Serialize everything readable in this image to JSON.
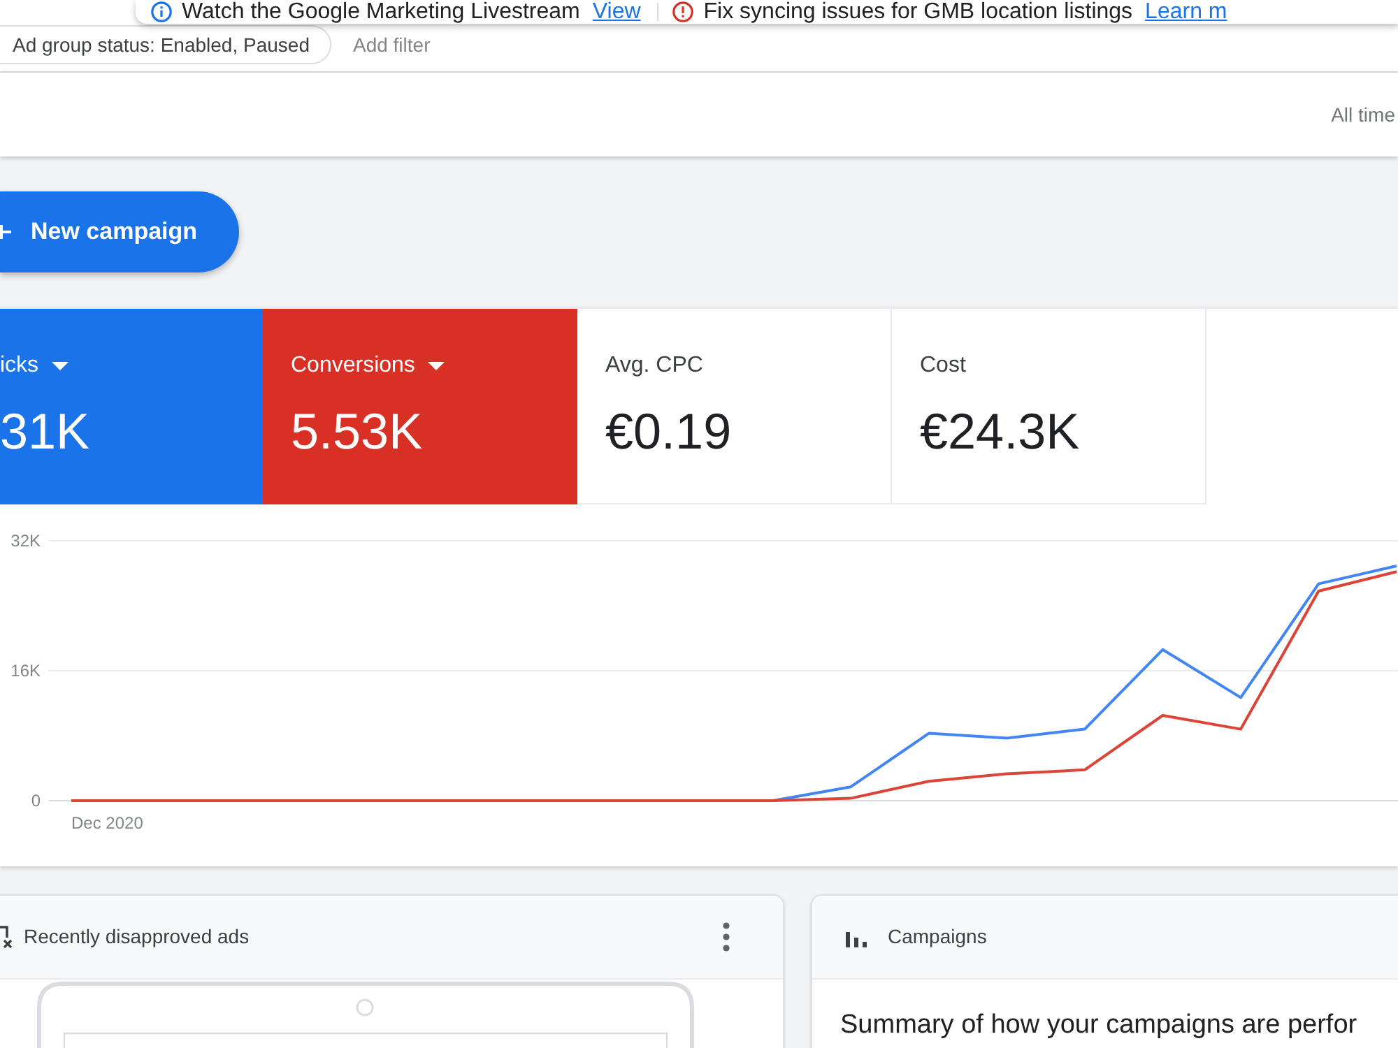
{
  "banner": {
    "messages": [
      {
        "kind": "info",
        "text": "Watch the Google Marketing Livestream",
        "link": "View"
      },
      {
        "kind": "error",
        "text": "Fix syncing issues for GMB location listings",
        "link": "Learn m"
      }
    ]
  },
  "filters": {
    "chips": [
      {
        "label": "Ad group status: Enabled, Paused"
      }
    ],
    "add_filter": "Add filter"
  },
  "date_range": "All time",
  "new_campaign_button": {
    "label": "New campaign"
  },
  "metrics": [
    {
      "label": "icks",
      "value": "31K",
      "selected": true,
      "color": "#1a73e8"
    },
    {
      "label": "Conversions",
      "value": "5.53K",
      "selected": true,
      "color": "#d93025"
    },
    {
      "label": "Avg. CPC",
      "value": "€0.19",
      "selected": false
    },
    {
      "label": "Cost",
      "value": "€24.3K",
      "selected": false
    }
  ],
  "chart": {
    "chart_data": {
      "type": "line",
      "categories": [
        "Dec 2020",
        null,
        null,
        null,
        null,
        null,
        null,
        null,
        null,
        null,
        null,
        null,
        null,
        null,
        null,
        null,
        null,
        null
      ],
      "ylim": [
        0,
        32000
      ],
      "yticks": [
        {
          "value": 0,
          "label": "0"
        },
        {
          "value": 16000,
          "label": "16K"
        },
        {
          "value": 32000,
          "label": "32K"
        }
      ],
      "series": [
        {
          "color": "#4285f4",
          "values": [
            null,
            null,
            null,
            null,
            null,
            null,
            null,
            null,
            0,
            0,
            1700,
            8300,
            7700,
            8800,
            18600,
            12700,
            26700,
            28900
          ]
        },
        {
          "color": "#db4437",
          "values": [
            0,
            0,
            0,
            0,
            0,
            0,
            0,
            0,
            0,
            0,
            300,
            2400,
            3300,
            3800,
            10500,
            8800,
            25800,
            28200
          ]
        }
      ]
    }
  },
  "cards": [
    {
      "kind": "disapproved_ads",
      "title": "Recently disapproved ads"
    },
    {
      "kind": "campaigns",
      "title": "Campaigns",
      "summary": "Summary of how your campaigns are perfor"
    }
  ]
}
